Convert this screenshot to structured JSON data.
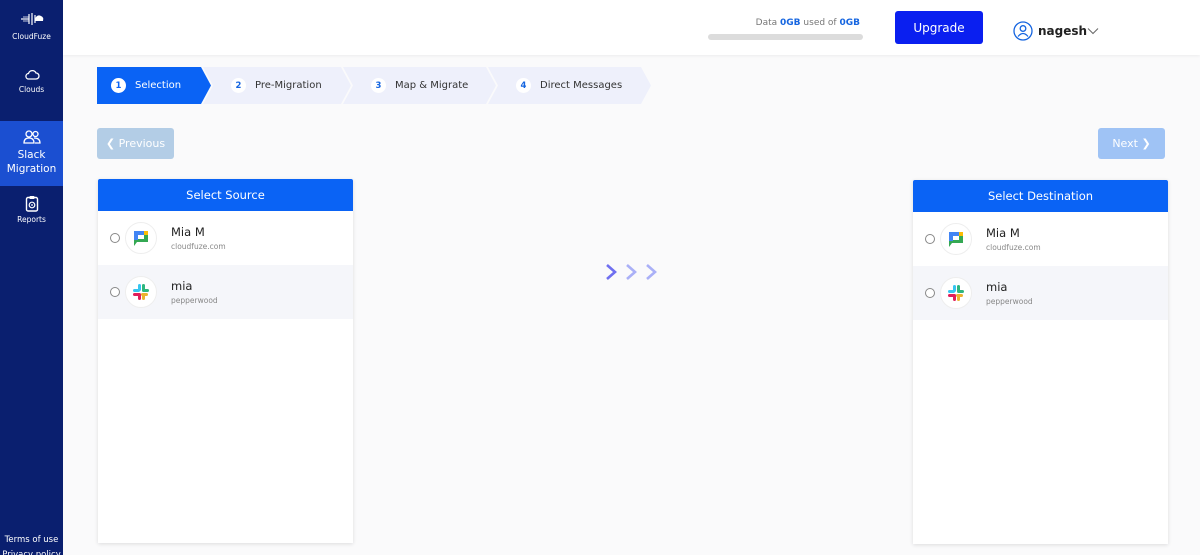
{
  "sidebar": {
    "brand": "CloudFuze",
    "items": [
      {
        "label": "Clouds",
        "icon": "cloud-icon"
      },
      {
        "label": "Slack Migration",
        "icon": "users-icon",
        "active": true
      },
      {
        "label": "Reports",
        "icon": "clipboard-icon"
      }
    ],
    "footer": [
      "Terms of use",
      "Privacy policy"
    ]
  },
  "topbar": {
    "usage_prefix": "Data",
    "usage_used": "0GB",
    "usage_middle": "used of",
    "usage_total": "0GB",
    "usage_percent": 0,
    "upgrade_label": "Upgrade",
    "username": "nagesh"
  },
  "stepper": [
    {
      "num": "1",
      "label": "Selection",
      "active": true
    },
    {
      "num": "2",
      "label": "Pre-Migration"
    },
    {
      "num": "3",
      "label": "Map & Migrate"
    },
    {
      "num": "4",
      "label": "Direct Messages"
    }
  ],
  "nav": {
    "previous_label": "Previous",
    "next_label": "Next"
  },
  "source": {
    "title": "Select Source",
    "accounts": [
      {
        "name": "Mia M",
        "sub": "cloudfuze.com",
        "type": "google-chat"
      },
      {
        "name": "mia",
        "sub": "pepperwood",
        "type": "slack"
      }
    ]
  },
  "destination": {
    "title": "Select Destination",
    "accounts": [
      {
        "name": "Mia M",
        "sub": "cloudfuze.com",
        "type": "google-chat"
      },
      {
        "name": "mia",
        "sub": "pepperwood",
        "type": "slack"
      }
    ]
  },
  "colors": {
    "sidebar_bg": "#0a1f6f",
    "sidebar_active": "#1b4fd1",
    "primary": "#0a63f5",
    "upgrade": "#0a1ff0"
  }
}
